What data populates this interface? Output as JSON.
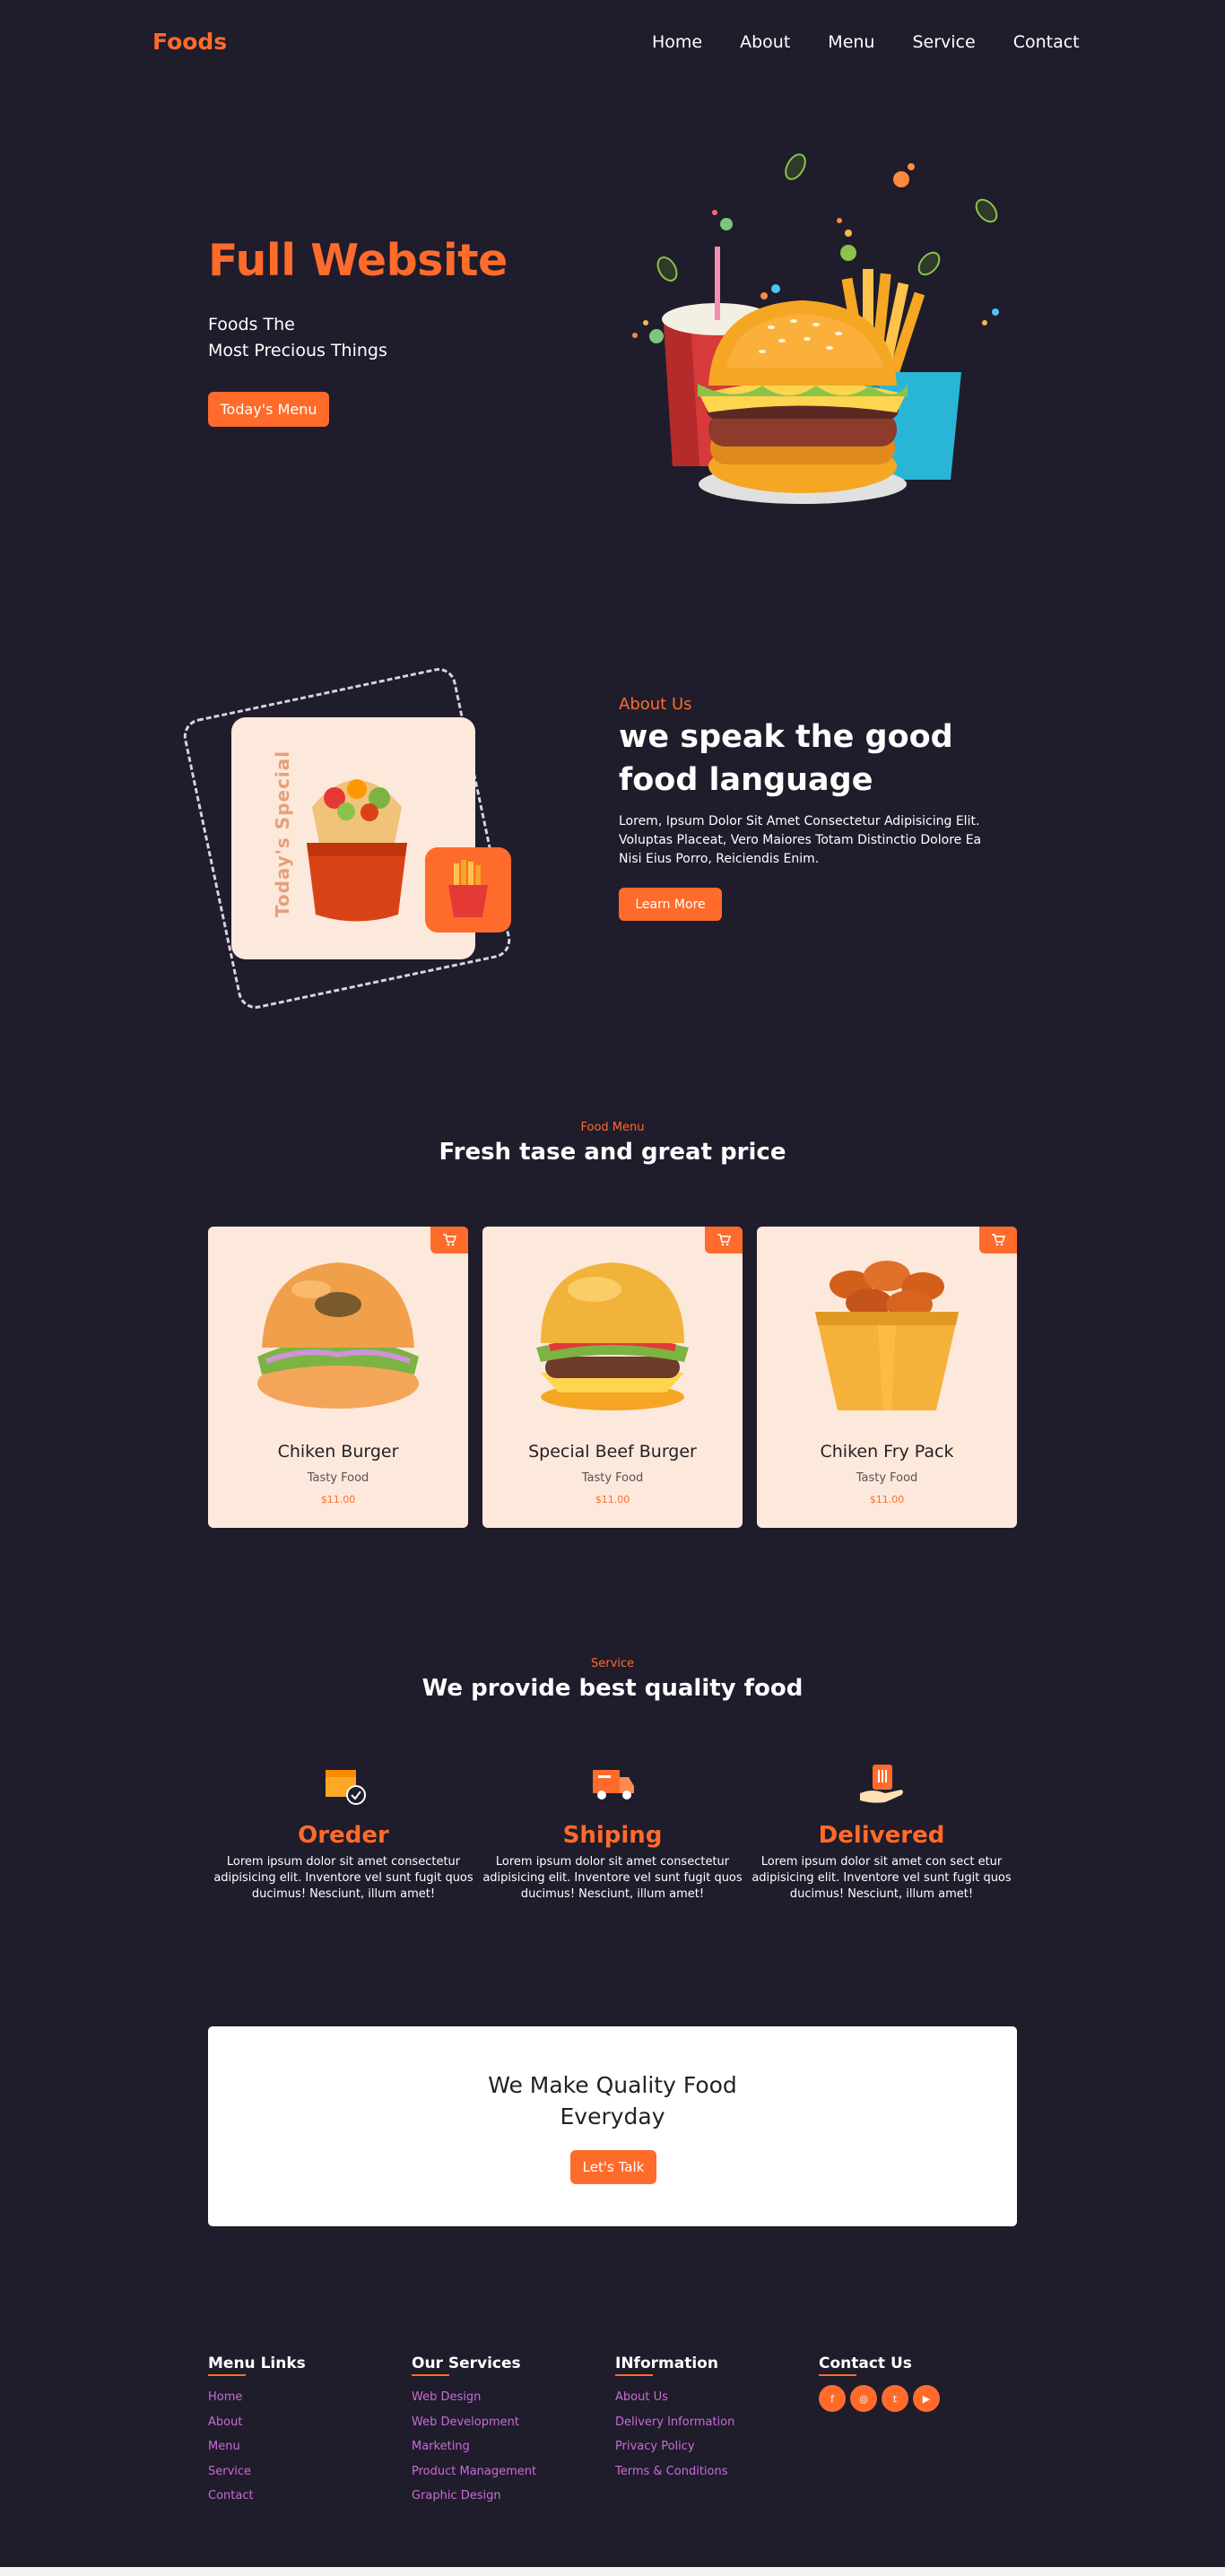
{
  "header": {
    "logo": "Foods",
    "nav": [
      "Home",
      "About",
      "Menu",
      "Service",
      "Contact"
    ]
  },
  "hero": {
    "title": "Full Website",
    "subtitle_line1": "Foods The",
    "subtitle_line2": "Most Precious Things",
    "button": "Today's Menu"
  },
  "about": {
    "special_label": "Today's Special",
    "label": "About Us",
    "title": "we speak the good food language",
    "text": "Lorem, Ipsum Dolor Sit Amet Consectetur Adipisicing Elit. Voluptas Placeat, Vero Maiores Totam Distinctio Dolore Ea Nisi Eius Porro, Reiciendis Enim.",
    "button": "Learn More"
  },
  "menu": {
    "label": "Food Menu",
    "title": "Fresh tase and great price",
    "items": [
      {
        "name": "Chiken Burger",
        "sub": "Tasty Food",
        "price": "$11.00"
      },
      {
        "name": "Special Beef Burger",
        "sub": "Tasty Food",
        "price": "$11.00"
      },
      {
        "name": "Chiken Fry Pack",
        "sub": "Tasty Food",
        "price": "$11.00"
      }
    ]
  },
  "service": {
    "label": "Service",
    "title": "We provide best quality food",
    "items": [
      {
        "title": "Oreder",
        "text": "Lorem ipsum dolor sit amet consectetur adipisicing elit. Inventore vel sunt fugit quos ducimus! Nesciunt, illum amet!"
      },
      {
        "title": "Shiping",
        "text": "Lorem ipsum dolor sit amet consectetur adipisicing elit. Inventore vel sunt fugit quos ducimus! Nesciunt, illum amet!"
      },
      {
        "title": "Delivered",
        "text": "Lorem ipsum dolor sit amet con sect etur adipisicing elit. Inventore vel sunt fugit quos ducimus! Nesciunt, illum amet!"
      }
    ]
  },
  "cta": {
    "line1": "We Make Quality Food",
    "line2": "Everyday",
    "button": "Let's Talk"
  },
  "footer": {
    "menu_links": {
      "heading": "Menu Links",
      "links": [
        "Home",
        "About",
        "Menu",
        "Service",
        "Contact"
      ]
    },
    "services": {
      "heading": "Our Services",
      "links": [
        "Web Design",
        "Web Development",
        "Marketing",
        "Product Management",
        "Graphic Design"
      ]
    },
    "information": {
      "heading": "INformation",
      "links": [
        "About Us",
        "Delivery Information",
        "Privacy Policy",
        "Terms & Conditions"
      ]
    },
    "contact": {
      "heading": "Contact Us",
      "icons": [
        "facebook-icon",
        "instagram-icon",
        "twitter-icon",
        "youtube-icon"
      ]
    }
  },
  "colors": {
    "accent": "#ff6b2b",
    "background": "#1f1c2c",
    "card": "#fde8dc",
    "link": "#c96bd6"
  }
}
